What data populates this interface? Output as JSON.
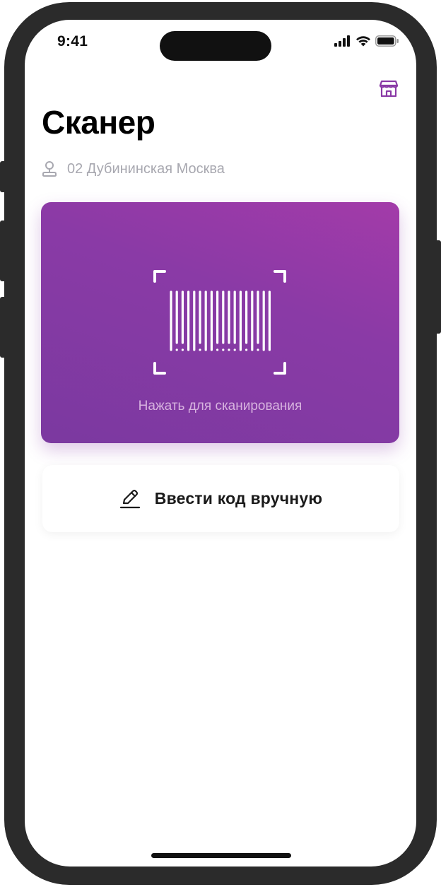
{
  "status_bar": {
    "time": "9:41",
    "icons": [
      "cellular-signal-icon",
      "wifi-icon",
      "battery-icon"
    ]
  },
  "header": {
    "title": "Сканер",
    "store_icon": "store-icon"
  },
  "location": {
    "icon": "location-pin-icon",
    "text": "02 Дубининская Москва"
  },
  "scanner": {
    "icon": "barcode-scan-icon",
    "label": "Нажать для сканирования"
  },
  "manual_entry": {
    "icon": "pencil-icon",
    "label": "Ввести код вручную"
  },
  "colors": {
    "accent": "#8a3aa6",
    "accent_light": "#a33ba9",
    "secondary_text": "#a8a8b0"
  }
}
